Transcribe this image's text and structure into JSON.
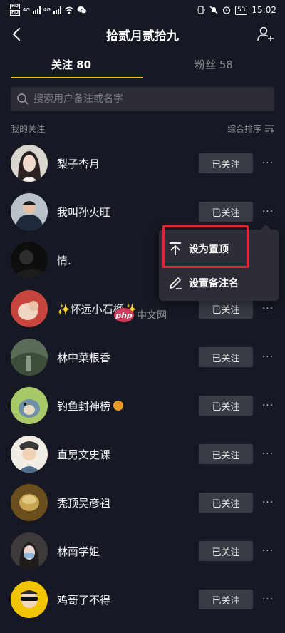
{
  "status_bar": {
    "carrier_left": "HD",
    "carrier_right": "HD",
    "net1": "4G",
    "net2": "4G",
    "battery": "53",
    "time": "15:02"
  },
  "header": {
    "title": "拾贰月贰拾九"
  },
  "tabs": [
    {
      "label": "关注 80",
      "active": true
    },
    {
      "label": "粉丝 58",
      "active": false
    }
  ],
  "search": {
    "placeholder": "搜索用户备注或名字"
  },
  "section": {
    "label": "我的关注",
    "sort_label": "综合排序"
  },
  "follow_label": "已关注",
  "more_label": "···",
  "users": [
    {
      "name": "梨子杏月"
    },
    {
      "name": "我叫孙火旺"
    },
    {
      "name": "情."
    },
    {
      "name": "✨怀远小石榴✨"
    },
    {
      "name": "林中菜根香"
    },
    {
      "name": "钓鱼封神榜"
    },
    {
      "name": "直男文史课"
    },
    {
      "name": "秃顶吴彦祖"
    },
    {
      "name": "林南学姐"
    },
    {
      "name": "鸡哥了不得"
    }
  ],
  "menu": {
    "pin_label": "设为置顶",
    "remark_label": "设置备注名"
  },
  "watermark": {
    "logo": "php",
    "text": "中文网"
  },
  "colors": {
    "background": "#161823",
    "accent": "#face15",
    "highlight": "#e3262c",
    "button": "#393b44"
  }
}
